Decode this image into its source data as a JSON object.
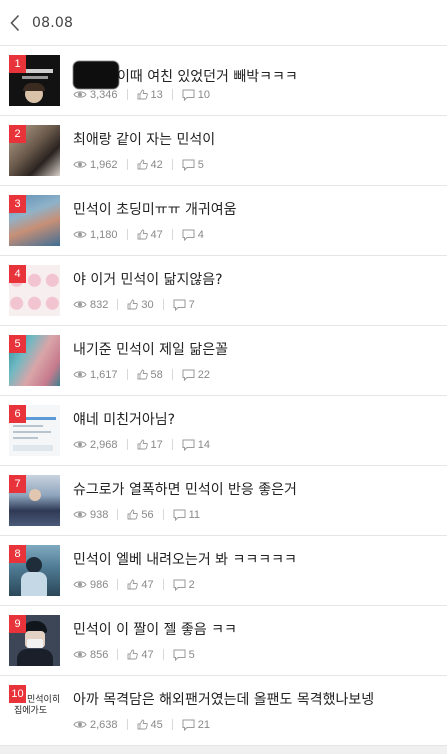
{
  "header": {
    "title": "08.08"
  },
  "colors": {
    "rank_badge": "#e8333b",
    "meta_text": "#888888",
    "divider": "#e6e6e6"
  },
  "thumbnails": {
    "1": {
      "label_a": "ASSAULT MUSIC",
      "label_b": "XIU"
    },
    "10": {
      "line1": "민석이히",
      "line2": "집에가도"
    }
  },
  "items": [
    {
      "rank": "1",
      "title": "이때 여친 있었던거 빼박ㅋㅋㅋ",
      "views": "3,346",
      "likes": "13",
      "comments": "10",
      "redacted_prefix": true
    },
    {
      "rank": "2",
      "title": "최애랑 같이 자는 민석이",
      "views": "1,962",
      "likes": "42",
      "comments": "5"
    },
    {
      "rank": "3",
      "title": "민석이 초딩미ㅠㅠ 개귀여움",
      "views": "1,180",
      "likes": "47",
      "comments": "4"
    },
    {
      "rank": "4",
      "title": "야 이거 민석이 닮지않음?",
      "views": "832",
      "likes": "30",
      "comments": "7"
    },
    {
      "rank": "5",
      "title": "내기준 민석이 제일 닮은꼴",
      "views": "1,617",
      "likes": "58",
      "comments": "22"
    },
    {
      "rank": "6",
      "title": "얘네 미친거아님?",
      "views": "2,968",
      "likes": "17",
      "comments": "14"
    },
    {
      "rank": "7",
      "title": "슈그로가 열폭하면 민석이 반응 좋은거",
      "views": "938",
      "likes": "56",
      "comments": "11"
    },
    {
      "rank": "8",
      "title": "민석이 엘베 내려오는거 봐 ㅋㅋㅋㅋㅋ",
      "views": "986",
      "likes": "47",
      "comments": "2"
    },
    {
      "rank": "9",
      "title": "민석이 이 짤이 젤 좋음 ㅋㅋ",
      "views": "856",
      "likes": "47",
      "comments": "5"
    },
    {
      "rank": "10",
      "title": "아까 목격담은 해외팬거였는데 올팬도 목격했나보넹",
      "views": "2,638",
      "likes": "45",
      "comments": "21"
    }
  ],
  "icons": {
    "back": "chevron-left-icon",
    "views": "eye-icon",
    "likes": "thumbs-up-icon",
    "comments": "comment-icon"
  }
}
